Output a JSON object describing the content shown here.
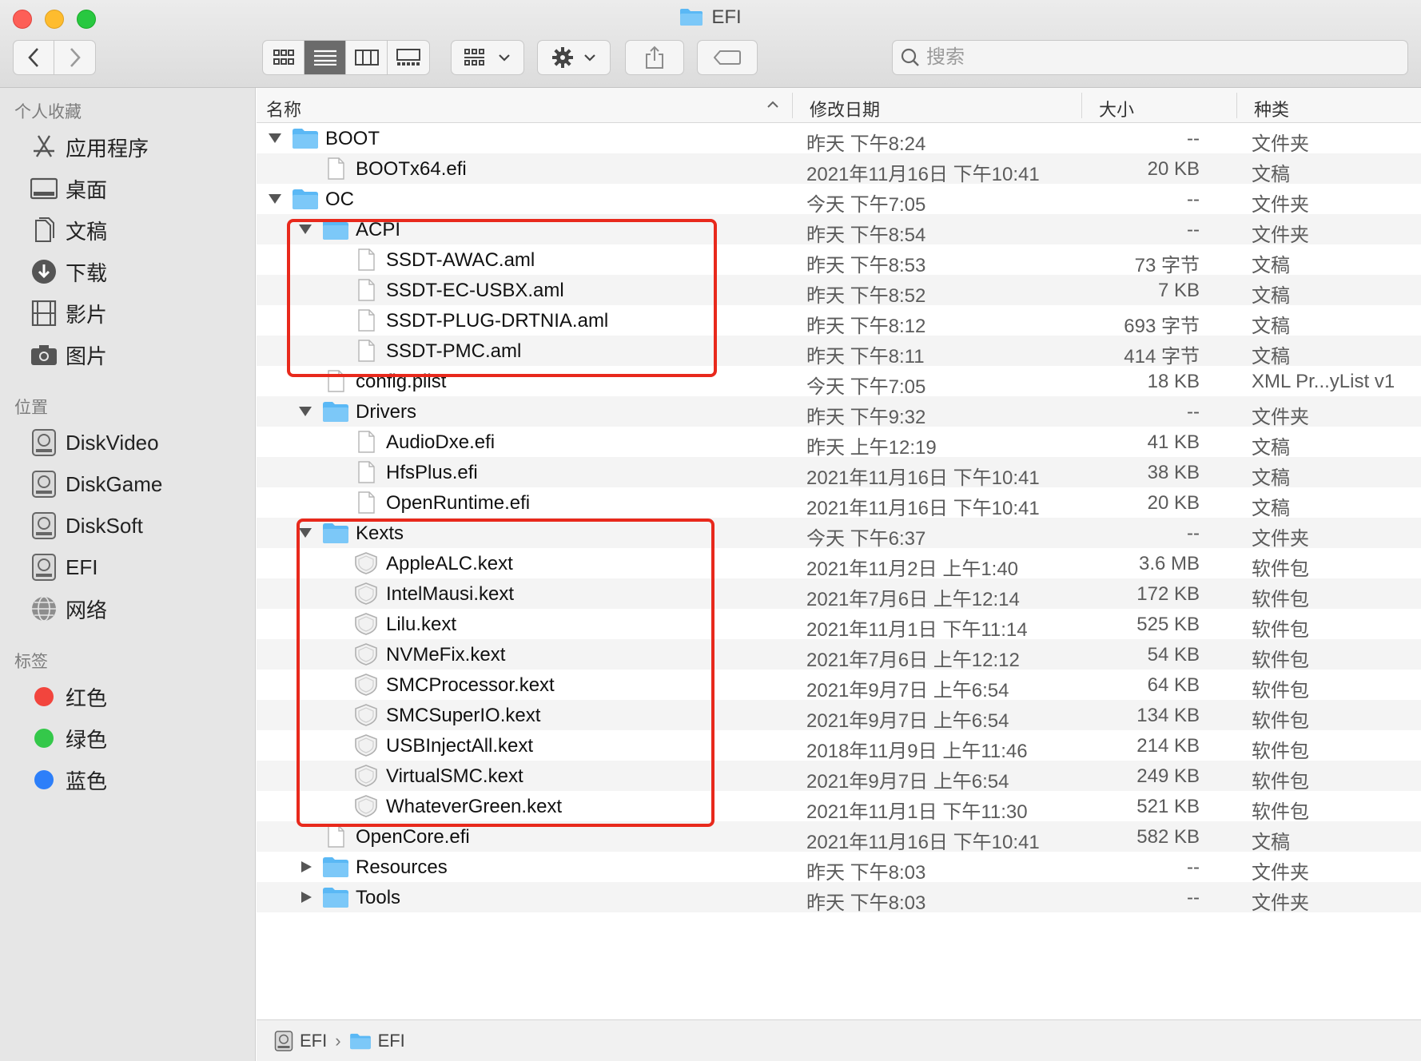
{
  "window": {
    "title": "EFI"
  },
  "toolbar": {
    "search_placeholder": "搜索",
    "icons": [
      "back-icon",
      "forward-icon",
      "icon-view-icon",
      "list-view-icon",
      "column-view-icon",
      "gallery-view-icon",
      "group-icon",
      "gear-icon",
      "share-icon",
      "tag-icon",
      "search-icon"
    ]
  },
  "sidebar": {
    "favorites_header": "个人收藏",
    "favorites": [
      "应用程序",
      "桌面",
      "文稿",
      "下载",
      "影片",
      "图片"
    ],
    "locations_header": "位置",
    "locations": [
      "DiskVideo",
      "DiskGame",
      "DiskSoft",
      "EFI",
      "网络"
    ],
    "tags_header": "标签",
    "tags": [
      {
        "label": "红色",
        "color": "#f2453d"
      },
      {
        "label": "绿色",
        "color": "#34c84a"
      },
      {
        "label": "蓝色",
        "color": "#2d7ff9"
      }
    ]
  },
  "columns": {
    "name": "名称",
    "date": "修改日期",
    "size": "大小",
    "kind": "种类"
  },
  "rows": [
    {
      "name": "BOOT",
      "date": "昨天 下午8:24",
      "size": "--",
      "kind": "文件夹"
    },
    {
      "name": "BOOTx64.efi",
      "date": "2021年11月16日 下午10:41",
      "size": "20 KB",
      "kind": "文稿"
    },
    {
      "name": "OC",
      "date": "今天 下午7:05",
      "size": "--",
      "kind": "文件夹"
    },
    {
      "name": "ACPI",
      "date": "昨天 下午8:54",
      "size": "--",
      "kind": "文件夹"
    },
    {
      "name": "SSDT-AWAC.aml",
      "date": "昨天 下午8:53",
      "size": "73 字节",
      "kind": "文稿"
    },
    {
      "name": "SSDT-EC-USBX.aml",
      "date": "昨天 下午8:52",
      "size": "7 KB",
      "kind": "文稿"
    },
    {
      "name": "SSDT-PLUG-DRTNIA.aml",
      "date": "昨天 下午8:12",
      "size": "693 字节",
      "kind": "文稿"
    },
    {
      "name": "SSDT-PMC.aml",
      "date": "昨天 下午8:11",
      "size": "414 字节",
      "kind": "文稿"
    },
    {
      "name": "config.plist",
      "date": "今天 下午7:05",
      "size": "18 KB",
      "kind": "XML Pr...yList v1"
    },
    {
      "name": "Drivers",
      "date": "昨天 下午9:32",
      "size": "--",
      "kind": "文件夹"
    },
    {
      "name": "AudioDxe.efi",
      "date": "昨天 上午12:19",
      "size": "41 KB",
      "kind": "文稿"
    },
    {
      "name": "HfsPlus.efi",
      "date": "2021年11月16日 下午10:41",
      "size": "38 KB",
      "kind": "文稿"
    },
    {
      "name": "OpenRuntime.efi",
      "date": "2021年11月16日 下午10:41",
      "size": "20 KB",
      "kind": "文稿"
    },
    {
      "name": "Kexts",
      "date": "今天 下午6:37",
      "size": "--",
      "kind": "文件夹"
    },
    {
      "name": "AppleALC.kext",
      "date": "2021年11月2日 上午1:40",
      "size": "3.6 MB",
      "kind": "软件包"
    },
    {
      "name": "IntelMausi.kext",
      "date": "2021年7月6日 上午12:14",
      "size": "172 KB",
      "kind": "软件包"
    },
    {
      "name": "Lilu.kext",
      "date": "2021年11月1日 下午11:14",
      "size": "525 KB",
      "kind": "软件包"
    },
    {
      "name": "NVMeFix.kext",
      "date": "2021年7月6日 上午12:12",
      "size": "54 KB",
      "kind": "软件包"
    },
    {
      "name": "SMCProcessor.kext",
      "date": "2021年9月7日 上午6:54",
      "size": "64 KB",
      "kind": "软件包"
    },
    {
      "name": "SMCSuperIO.kext",
      "date": "2021年9月7日 上午6:54",
      "size": "134 KB",
      "kind": "软件包"
    },
    {
      "name": "USBInjectAll.kext",
      "date": "2018年11月9日 上午11:46",
      "size": "214 KB",
      "kind": "软件包"
    },
    {
      "name": "VirtualSMC.kext",
      "date": "2021年9月7日 上午6:54",
      "size": "249 KB",
      "kind": "软件包"
    },
    {
      "name": "WhateverGreen.kext",
      "date": "2021年11月1日 下午11:30",
      "size": "521 KB",
      "kind": "软件包"
    },
    {
      "name": "OpenCore.efi",
      "date": "2021年11月16日 下午10:41",
      "size": "582 KB",
      "kind": "文稿"
    },
    {
      "name": "Resources",
      "date": "昨天 下午8:03",
      "size": "--",
      "kind": "文件夹"
    },
    {
      "name": "Tools",
      "date": "昨天 下午8:03",
      "size": "--",
      "kind": "文件夹"
    }
  ],
  "pathbar": [
    "EFI",
    "EFI"
  ],
  "colors": {
    "highlight": "#e8291c",
    "folder": "#5ab8f5"
  }
}
